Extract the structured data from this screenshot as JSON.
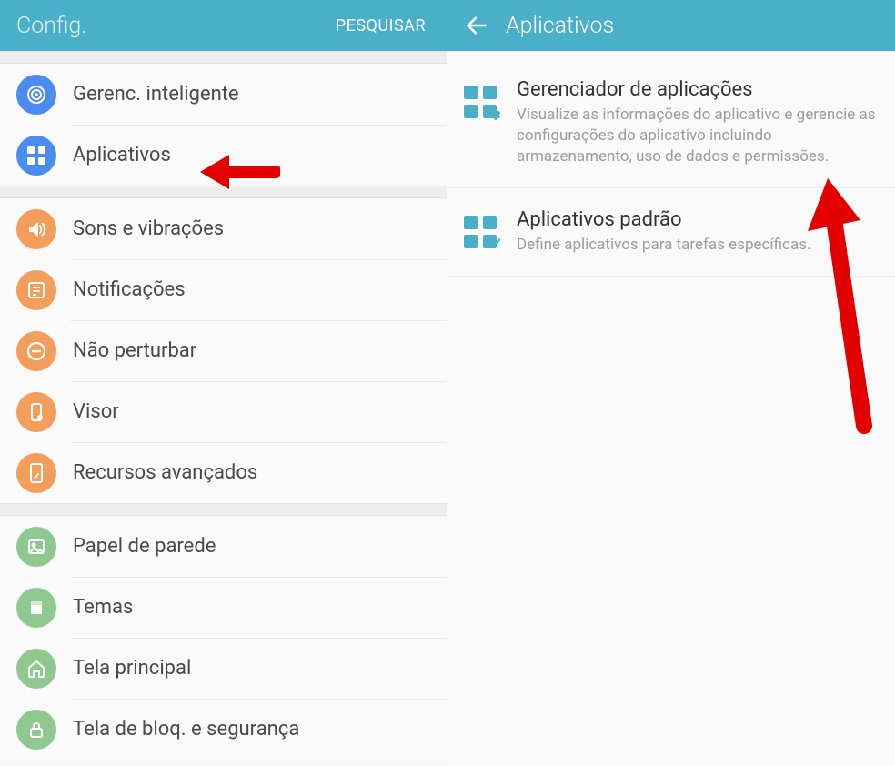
{
  "colors": {
    "header_bg": "#4ab0ca",
    "orange": "#f39e5c",
    "blue": "#4b8cf0",
    "blue_light": "#4ab0ca"
  },
  "left": {
    "header": {
      "title": "Config.",
      "search_label": "PESQUISAR"
    },
    "groups": [
      {
        "items": [
          {
            "id": "gerenc-inteligente",
            "label": "Gerenc. inteligente",
            "icon": "target-icon",
            "color": "#4b8cf0"
          },
          {
            "id": "aplicativos",
            "label": "Aplicativos",
            "icon": "grid-icon",
            "color": "#4b8cf0"
          }
        ]
      },
      {
        "items": [
          {
            "id": "sons-vibracoes",
            "label": "Sons e vibrações",
            "icon": "sound-icon",
            "color": "#f39e5c"
          },
          {
            "id": "notificacoes",
            "label": "Notificações",
            "icon": "notification-icon",
            "color": "#f39e5c"
          },
          {
            "id": "nao-perturbar",
            "label": "Não perturbar",
            "icon": "dnd-icon",
            "color": "#f39e5c"
          },
          {
            "id": "visor",
            "label": "Visor",
            "icon": "display-icon",
            "color": "#f39e5c"
          },
          {
            "id": "recursos-avancados",
            "label": "Recursos avançados",
            "icon": "advanced-icon",
            "color": "#f39e5c"
          }
        ]
      },
      {
        "items": [
          {
            "id": "papel-parede",
            "label": "Papel de parede",
            "icon": "wallpaper-icon",
            "color": "#8fc98f"
          },
          {
            "id": "temas",
            "label": "Temas",
            "icon": "themes-icon",
            "color": "#8fc98f"
          },
          {
            "id": "tela-principal",
            "label": "Tela principal",
            "icon": "home-icon",
            "color": "#8fc98f"
          },
          {
            "id": "tela-bloq-seguranca",
            "label": "Tela de bloq. e segurança",
            "icon": "lock-icon",
            "color": "#8fc98f"
          }
        ]
      }
    ]
  },
  "right": {
    "header": {
      "title": "Aplicativos"
    },
    "items": [
      {
        "id": "gerenciador-aplicacoes",
        "title": "Gerenciador de aplicações",
        "subtitle": "Visualize as informações do aplicativo e gerencie as configurações do aplicativo incluindo armazenamento, uso de dados e permissões.",
        "badge": "gear"
      },
      {
        "id": "aplicativos-padrao",
        "title": "Aplicativos padrão",
        "subtitle": "Define aplicativos para tarefas específicas.",
        "badge": "check"
      }
    ]
  }
}
